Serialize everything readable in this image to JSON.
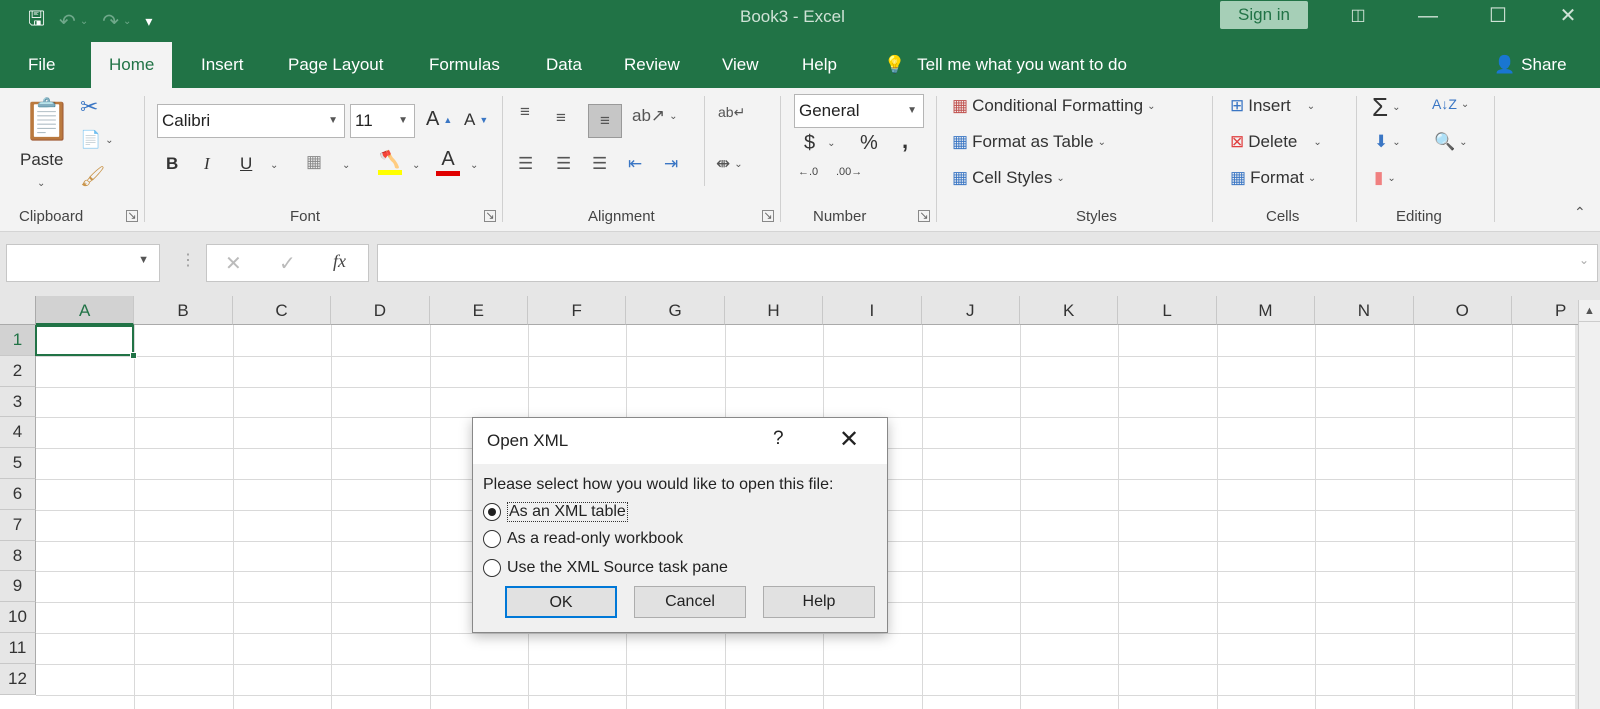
{
  "titlebar": {
    "title": "Book3  -  Excel",
    "sign_in": "Sign in",
    "qat": [
      "save-icon",
      "undo-icon",
      "redo-icon",
      "customize-qat-icon"
    ]
  },
  "tabs": [
    "File",
    "Home",
    "Insert",
    "Page Layout",
    "Formulas",
    "Data",
    "Review",
    "View",
    "Help"
  ],
  "active_tab": "Home",
  "tell_me": "Tell me what you want to do",
  "share": "Share",
  "ribbon": {
    "clipboard": {
      "label": "Clipboard",
      "paste": "Paste"
    },
    "font": {
      "label": "Font",
      "font_name": "Calibri",
      "font_size": "11",
      "bold": "B",
      "italic": "I",
      "underline": "U",
      "fill_color": "#ffff00",
      "font_color": "#e00000"
    },
    "alignment": {
      "label": "Alignment"
    },
    "number": {
      "label": "Number",
      "format": "General",
      "currency": "$",
      "percent": "%",
      "comma": ","
    },
    "styles": {
      "label": "Styles",
      "conditional": "Conditional Formatting",
      "format_table": "Format as Table",
      "cell_styles": "Cell Styles"
    },
    "cells": {
      "label": "Cells",
      "insert": "Insert",
      "delete": "Delete",
      "format": "Format"
    },
    "editing": {
      "label": "Editing"
    }
  },
  "formula_bar": {
    "name_box": "",
    "formula": "",
    "fx": "fx"
  },
  "grid": {
    "columns": [
      "A",
      "B",
      "C",
      "D",
      "E",
      "F",
      "G",
      "H",
      "I",
      "J",
      "K",
      "L",
      "M",
      "N",
      "O",
      "P"
    ],
    "rows": [
      "1",
      "2",
      "3",
      "4",
      "5",
      "6",
      "7",
      "8",
      "9",
      "10",
      "11",
      "12"
    ],
    "active_cell": "A1"
  },
  "dialog": {
    "title": "Open XML",
    "help": "?",
    "prompt": "Please select how you would like to open this file:",
    "options": [
      {
        "label": "As an XML table",
        "selected": true
      },
      {
        "label": "As a read-only workbook",
        "selected": false
      },
      {
        "label": "Use the XML Source task pane",
        "selected": false
      }
    ],
    "ok": "OK",
    "cancel": "Cancel",
    "help_button": "Help"
  }
}
